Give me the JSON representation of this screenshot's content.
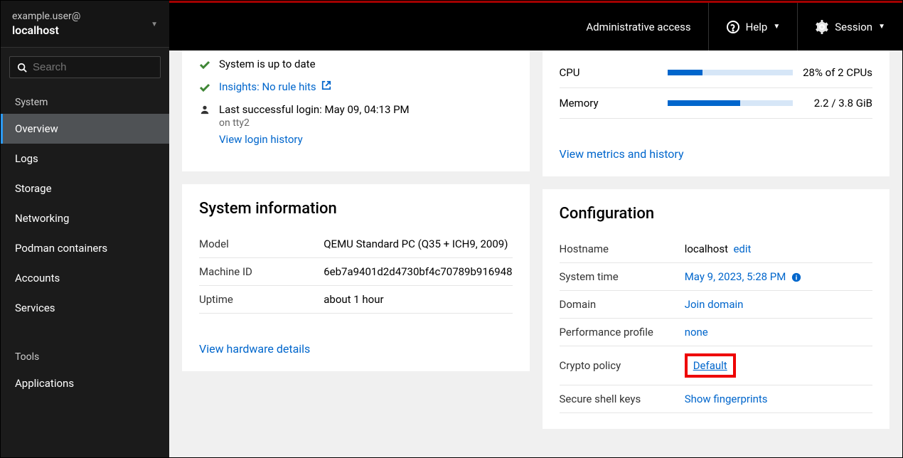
{
  "user": {
    "name": "example.user@",
    "host": "localhost"
  },
  "search": {
    "placeholder": "Search"
  },
  "nav": {
    "system_head": "System",
    "items": [
      "Overview",
      "Logs",
      "Storage",
      "Networking",
      "Podman containers",
      "Accounts",
      "Services"
    ],
    "tools_head": "Tools",
    "tools": [
      "Applications"
    ]
  },
  "topbar": {
    "admin": "Administrative access",
    "help": "Help",
    "session": "Session"
  },
  "health": {
    "uptodate": "System is up to date",
    "insights": "Insights: No rule hits",
    "login": "Last successful login: May 09, 04:13 PM",
    "login_tty": "on tty2",
    "login_history": "View login history"
  },
  "usage": {
    "cpu_label": "CPU",
    "cpu_val": "28% of 2 CPUs",
    "cpu_pct": 28,
    "mem_label": "Memory",
    "mem_val": "2.2 / 3.8 GiB",
    "mem_pct": 58,
    "metrics_link": "View metrics and history"
  },
  "sysinfo": {
    "title": "System information",
    "model_l": "Model",
    "model_v": "QEMU Standard PC (Q35 + ICH9, 2009)",
    "machine_l": "Machine ID",
    "machine_v": "6eb7a9401d2d4730bf4c70789b916948",
    "uptime_l": "Uptime",
    "uptime_v": "about 1 hour",
    "hw_link": "View hardware details"
  },
  "config": {
    "title": "Configuration",
    "hostname_l": "Hostname",
    "hostname_v": "localhost",
    "edit": "edit",
    "time_l": "System time",
    "time_v": "May 9, 2023, 5:28 PM",
    "domain_l": "Domain",
    "domain_v": "Join domain",
    "perf_l": "Performance profile",
    "perf_v": "none",
    "crypto_l": "Crypto policy",
    "crypto_v": "Default",
    "ssh_l": "Secure shell keys",
    "ssh_v": "Show fingerprints"
  }
}
